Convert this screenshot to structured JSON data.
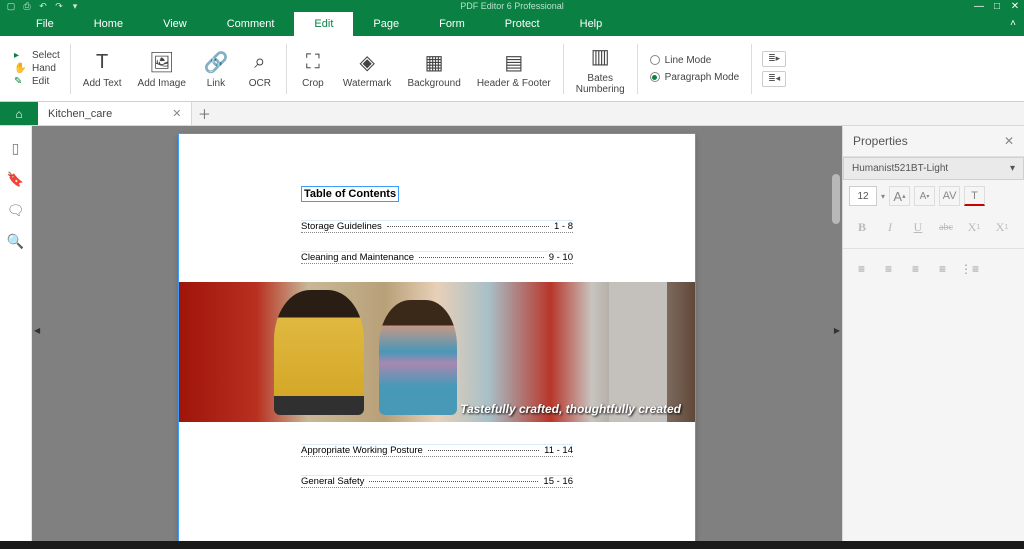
{
  "app_title": "PDF Editor 6 Professional",
  "menu": {
    "file": "File",
    "home": "Home",
    "view": "View",
    "comment": "Comment",
    "edit": "Edit",
    "page": "Page",
    "form": "Form",
    "protect": "Protect",
    "help": "Help"
  },
  "small_tools": {
    "select": "Select",
    "hand": "Hand",
    "edit": "Edit"
  },
  "ribbon": {
    "add_text": "Add Text",
    "add_image": "Add Image",
    "link": "Link",
    "ocr": "OCR",
    "crop": "Crop",
    "watermark": "Watermark",
    "background": "Background",
    "header_footer": "Header & Footer",
    "bates": "Bates\nNumbering"
  },
  "mode": {
    "line": "Line Mode",
    "paragraph": "Paragraph Mode"
  },
  "tab": {
    "name": "Kitchen_care"
  },
  "doc": {
    "toc_title": "Table of Contents",
    "rows": [
      {
        "t": "Storage Guidelines",
        "p": "1 - 8"
      },
      {
        "t": "Cleaning and Maintenance",
        "p": "9 - 10"
      }
    ],
    "rows2": [
      {
        "t": "Appropriate Working Posture",
        "p": "11 - 14"
      },
      {
        "t": "General Safety",
        "p": "15 - 16"
      }
    ],
    "image_caption": "Tastefully crafted, thoughtfully created"
  },
  "props": {
    "title": "Properties",
    "font": "Humanist521BT-Light",
    "size": "12",
    "inc": "A",
    "dec": "A",
    "bold": "B",
    "italic": "I",
    "underline": "U",
    "strike": "abc",
    "sup": "X",
    "sub": "X"
  }
}
